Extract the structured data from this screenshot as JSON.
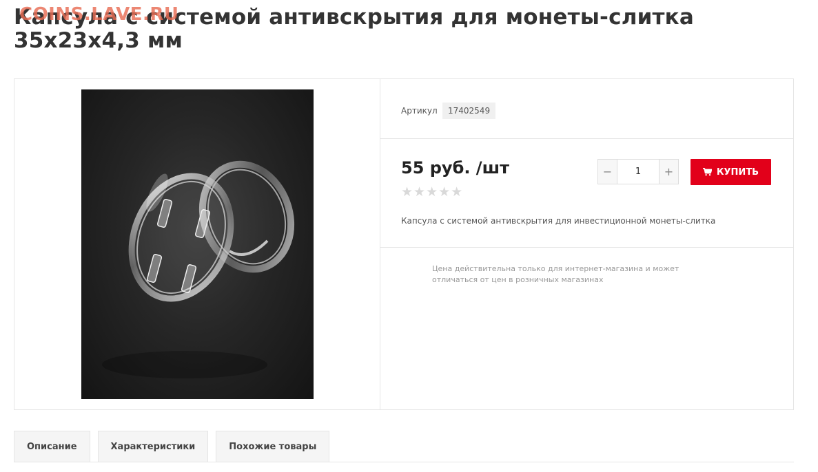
{
  "page": {
    "title": "Капсула с системой антивскрытия для монеты-слитка 35х23х4,3 мм",
    "watermark": "COINS.LAVE.RU"
  },
  "product": {
    "image_alt": "Капсула с системой антивскрытия для монеты-слитка",
    "sku_label": "Артикул",
    "sku_value": "17402549",
    "price": "55 руб. /шт",
    "rating_stars": "★★★★★",
    "rating": 0,
    "quantity": "1",
    "qty_minus": "−",
    "qty_plus": "+",
    "buy_label": "КУПИТЬ",
    "buy_icon": "cart-icon",
    "description": "Капсула с системой антивскрытия для инвестиционной монеты-слитка",
    "price_note": "Цена действительна только для интернет-магазина и может отличаться от цен в розничных магазинах"
  },
  "tabs": [
    {
      "label": "Описание"
    },
    {
      "label": "Характеристики"
    },
    {
      "label": "Похожие товары"
    }
  ],
  "colors": {
    "accent": "#e2001a",
    "text": "#333333",
    "border": "#e5e5e5"
  }
}
